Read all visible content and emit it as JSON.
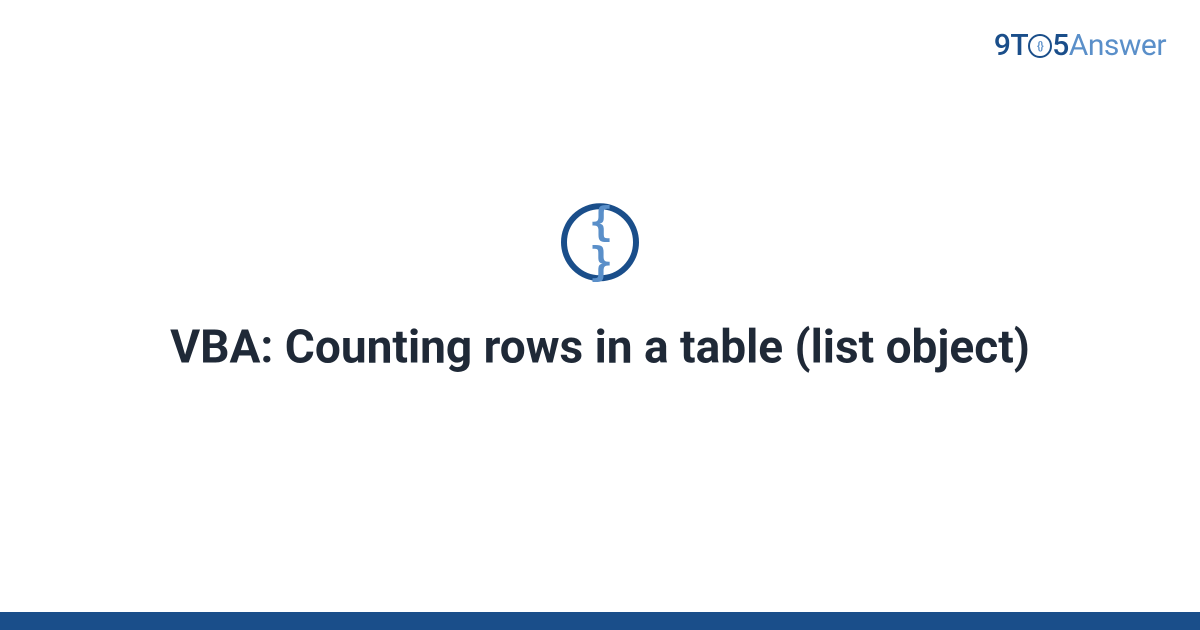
{
  "logo": {
    "part1": "9",
    "part2": "T",
    "part_o_inner": "{}",
    "part3": "5",
    "part4": "Answer"
  },
  "icon": {
    "name": "curly-braces-icon",
    "glyph": "{ }"
  },
  "title": "VBA: Counting rows in a table (list object)",
  "colors": {
    "primary": "#1a4e8a",
    "secondary": "#5a8fc9"
  }
}
